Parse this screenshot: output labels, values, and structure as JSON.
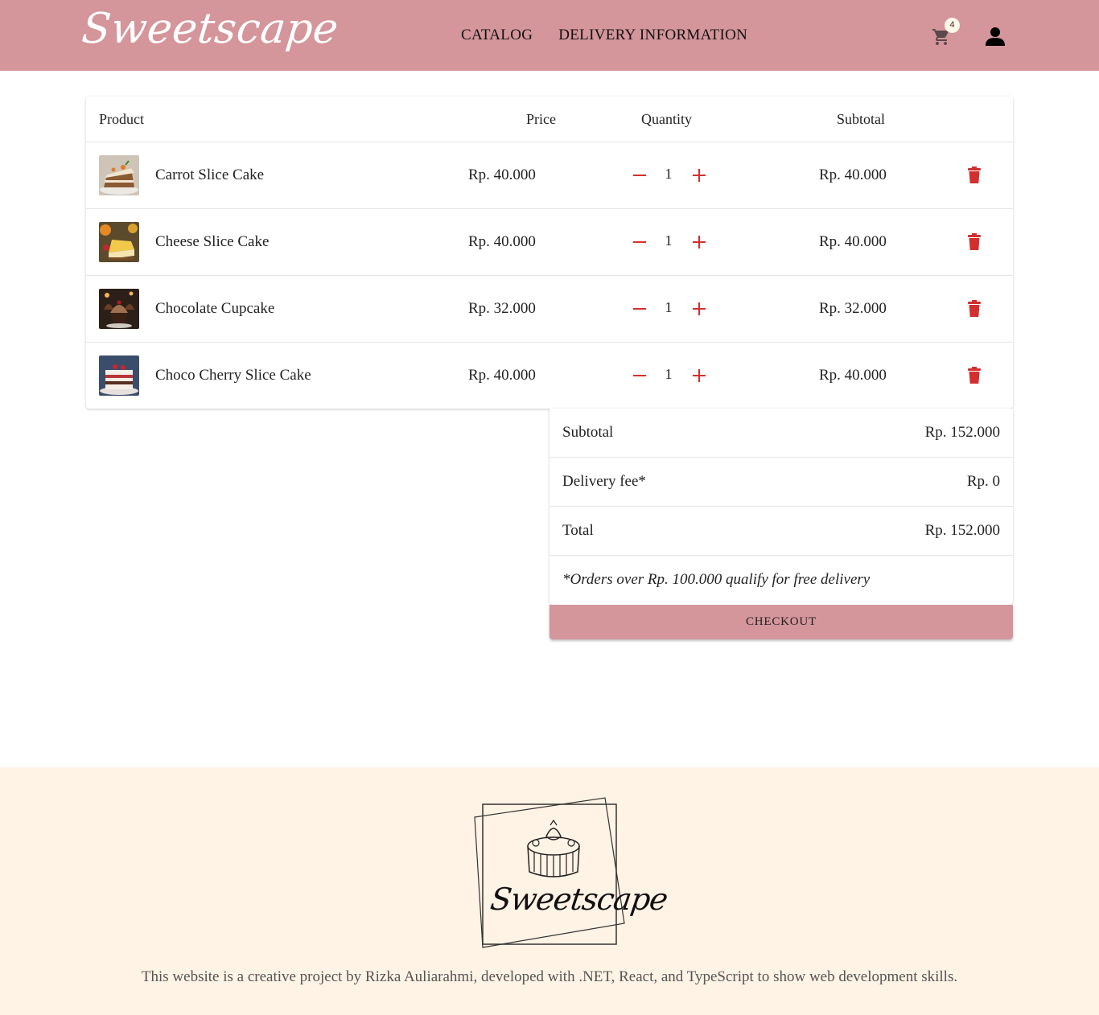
{
  "header": {
    "brand": "Sweetscape",
    "nav": [
      {
        "label": "CATALOG"
      },
      {
        "label": "DELIVERY INFORMATION"
      }
    ],
    "cart_count": "4",
    "cart_icon": "shopping-cart-icon",
    "user_icon": "user-icon",
    "colors": {
      "bar": "#d4959b",
      "accent": "#d32f2f"
    }
  },
  "cart": {
    "headers": {
      "product": "Product",
      "price": "Price",
      "quantity": "Quantity",
      "subtotal": "Subtotal"
    },
    "items": [
      {
        "name": "Carrot Slice Cake",
        "price": "Rp. 40.000",
        "quantity": "1",
        "subtotal": "Rp. 40.000"
      },
      {
        "name": "Cheese Slice Cake",
        "price": "Rp. 40.000",
        "quantity": "1",
        "subtotal": "Rp. 40.000"
      },
      {
        "name": "Chocolate Cupcake",
        "price": "Rp. 32.000",
        "quantity": "1",
        "subtotal": "Rp. 32.000"
      },
      {
        "name": "Choco Cherry Slice Cake",
        "price": "Rp. 40.000",
        "quantity": "1",
        "subtotal": "Rp. 40.000"
      }
    ]
  },
  "summary": {
    "subtotal_label": "Subtotal",
    "subtotal_value": "Rp. 152.000",
    "delivery_label": "Delivery fee*",
    "delivery_value": "Rp. 0",
    "total_label": "Total",
    "total_value": "Rp. 152.000",
    "note": "*Orders over Rp. 100.000 qualify for free delivery",
    "checkout_label": "CHECKOUT"
  },
  "footer": {
    "logo_text": "Sweetscape",
    "text": "This website is a creative project by Rizka Auliarahmi, developed with .NET, React, and TypeScript to show web development skills."
  }
}
